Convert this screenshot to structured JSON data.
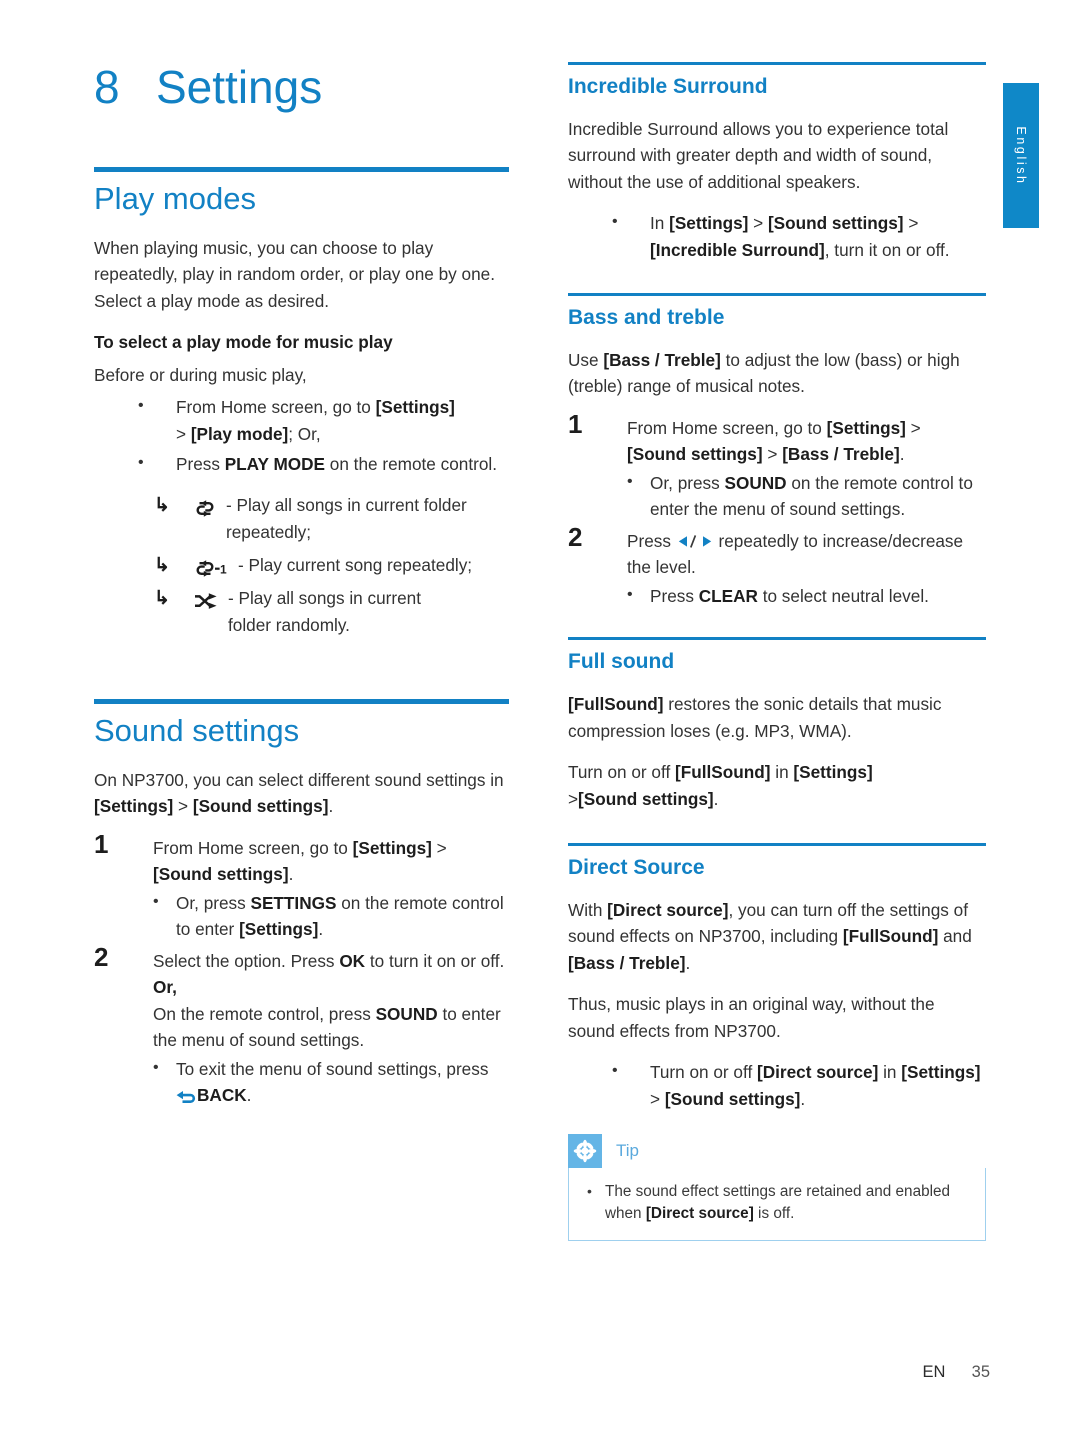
{
  "language_tab": {
    "label": "English"
  },
  "footer": {
    "locale": "EN",
    "page_number": "35"
  },
  "chapter": {
    "number": "8",
    "title": "Settings"
  },
  "left_column": {
    "play_modes": {
      "heading": "Play modes",
      "intro": "When playing music, you can choose to play repeatedly, play in random order, or play one by one. Select a play mode as desired.",
      "subheading": "To select a play mode for music play",
      "lead": "Before or during music play,",
      "bullets": [
        "From Home screen, go to [Settings] > [Play mode]; Or,",
        "Press PLAY MODE on the remote control."
      ],
      "modes": [
        {
          "icon": "repeat-all-icon",
          "text": "- Play all songs in current folder repeatedly;"
        },
        {
          "icon": "repeat-one-icon",
          "text": "- Play current song repeatedly;"
        },
        {
          "icon": "shuffle-icon",
          "text": "- Play all songs in current folder randomly."
        }
      ]
    },
    "sound_settings": {
      "heading": "Sound settings",
      "intro": "On NP3700, you can select different sound settings in [Settings] > [Sound settings].",
      "step1": "From Home screen, go to [Settings] > [Sound settings].",
      "step1_bullet": "Or, press SETTINGS on the remote control to enter [Settings].",
      "step2_a": "Select the option. Press OK to turn it on or off.",
      "step2_or": "Or,",
      "step2_b": "On the remote control, press SOUND to enter the menu of sound settings.",
      "step2_bullet": "To exit the menu of sound settings, press BACK."
    }
  },
  "right_column": {
    "incredible_surround": {
      "heading": "Incredible Surround",
      "intro": "Incredible Surround allows you to experience total surround with greater depth and width of sound, without the use of additional speakers.",
      "bullet": "In [Settings] > [Sound settings] > [Incredible Surround], turn it on or off."
    },
    "bass_and_treble": {
      "heading": "Bass and treble",
      "intro": "Use [Bass / Treble] to adjust the low (bass) or high (treble) range of musical notes.",
      "step1": "From Home screen, go to [Settings] > [Sound settings] > [Bass / Treble].",
      "step1_bullet": "Or, press SOUND on the remote control to enter the menu of sound settings.",
      "step2": "Press ◀/▶ repeatedly to increase/decrease the level.",
      "step2_bullet": "Press CLEAR to select neutral level."
    },
    "full_sound": {
      "heading": "Full sound",
      "para1": "[FullSound] restores the sonic details that music compression loses (e.g. MP3, WMA).",
      "para2": "Turn on or off [FullSound] in [Settings] >[Sound settings]."
    },
    "direct_source": {
      "heading": "Direct Source",
      "para1": "With [Direct source], you can turn off the settings of sound effects on NP3700, including [FullSound] and [Bass / Treble].",
      "para2": "Thus, music plays in an original way, without the sound effects from NP3700.",
      "bullet": "Turn on or off [Direct source] in [Settings] > [Sound settings]."
    },
    "tip": {
      "label": "Tip",
      "icon": "tip-asterisk-icon",
      "items": [
        "The sound effect settings are retained and enabled when [Direct source] is off."
      ]
    }
  },
  "colors": {
    "brand_blue": "#1281c4",
    "tab_blue": "#0f88c8",
    "tip_badge_blue": "#64b5e6",
    "tip_border_blue": "#9fd0ee",
    "body_text": "#333333"
  }
}
